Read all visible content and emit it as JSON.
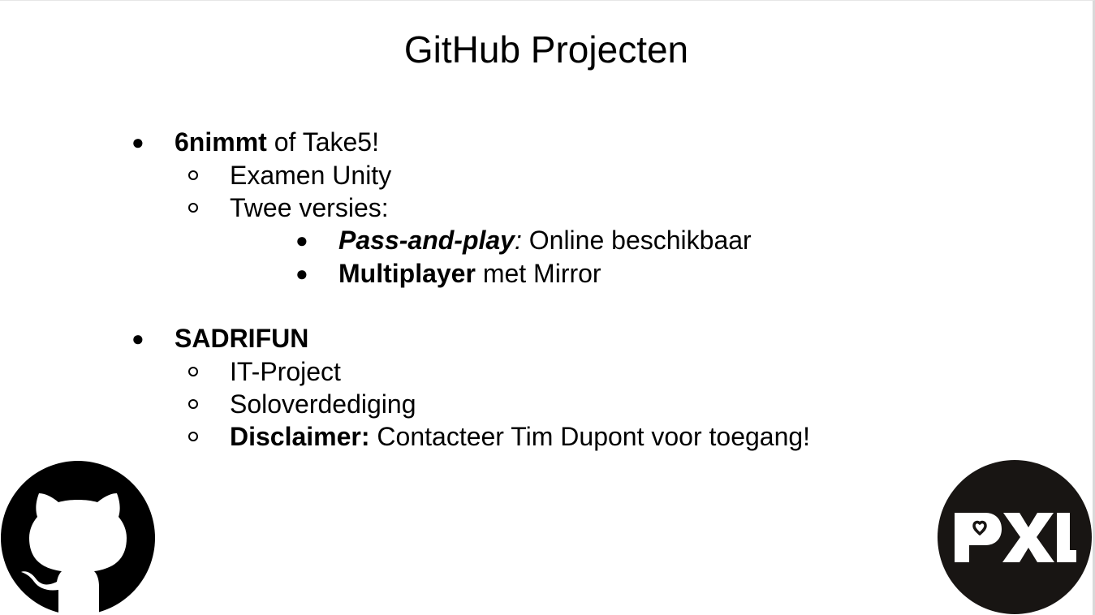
{
  "slide": {
    "title": "GitHub Projecten",
    "items": [
      {
        "bold": "6nimmt",
        "rest": " of Take5!",
        "sub": [
          {
            "text": "Examen Unity"
          },
          {
            "text": "Twee versies:"
          }
        ],
        "subsub": [
          {
            "bold_italic": "Pass-and-play",
            "italic": ":",
            "rest": " Online beschikbaar"
          },
          {
            "bold": "Multiplayer",
            "rest": " met Mirror"
          }
        ]
      },
      {
        "bold": "SADRIFUN",
        "sub": [
          {
            "text": "IT-Project"
          },
          {
            "text": "Soloverdediging"
          },
          {
            "bold": "Disclaimer:",
            "rest": " Contacteer Tim Dupont voor toegang!"
          }
        ]
      }
    ]
  },
  "logos": {
    "github": "github-octocat-logo",
    "pxl": "PXL"
  },
  "colors": {
    "background": "#ffffff",
    "text": "#000000",
    "pxl_circle": "#181513"
  }
}
